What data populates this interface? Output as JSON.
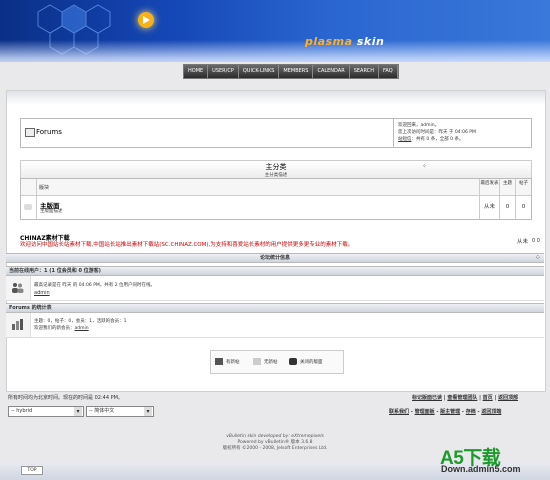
{
  "brand": {
    "name_plasma": "plasma",
    "name_skin": "skin"
  },
  "nav": [
    "HOME",
    "USER/CP",
    "QUICK-LINKS",
    "MEMBERS",
    "CALENDAR",
    "SEARCH",
    "FAQ"
  ],
  "breadcrumb": {
    "title": "Forums"
  },
  "welcome": {
    "line1": "欢迎回来，admin。",
    "line2": "您上次访问时间是：昨天 于 04:06 PM",
    "line3_link": "站短信",
    "line3_rest": "：共有 0 条，全部 0 条。"
  },
  "category": {
    "title": "主分类",
    "subtitle": "主分类描述"
  },
  "table_headers": {
    "forum": "版块",
    "last_post": "最后发表",
    "threads": "主题",
    "posts": "帖子"
  },
  "forum_row": {
    "name": "主版面",
    "desc": "主版面描述",
    "last_post": "从未",
    "threads": "0",
    "posts": "0"
  },
  "ad": {
    "title": "CHINAZ素材下载",
    "text": "欢迎访问中国站长站素材下载,中国站长站推出素材下载站(SC.CHINAZ.COM),为支持和喜爱站长素材的用户提供更多更专业的素材下载。",
    "last_post": "从未",
    "count": "0 0"
  },
  "stats": {
    "header": "论坛统计信息",
    "online_title": "当前在线用户：1 (1 位会员和 0 位游客)",
    "online_text": "最高记录是在 昨天 的 04:06 PM，共有 2 位用户同时在线。",
    "online_user": "admin",
    "forum_stats_title": "Forums 的统计表",
    "forum_stats_text": "主题：0，帖子：0，会员：1，活跃的会员：1",
    "newest_label": "欢迎我们的新会员：",
    "newest_user": "admin"
  },
  "legend": {
    "new": "有新帖",
    "nonew": "无新帖",
    "closed": "关闭的版面"
  },
  "footer": {
    "timezone": "所有时间均为北京时间。现在的时间是 02:44 PM。",
    "links_top": [
      "标记版面已读",
      "查看管理团队",
      "首页",
      "返回顶部"
    ],
    "style_select": "-- hybrid",
    "lang_select": "-- 简体中文",
    "links_bottom": [
      "联系我们",
      "管理面板",
      "版主管理",
      "存档",
      "返回顶端"
    ],
    "credit1": "vBulletin skin developed by: eXtremepixels",
    "credit2": "Powered by vBulletin® 版本 3.6.8",
    "credit3": "版权所有 ©2000 - 2008, Jelsoft Enterprises Ltd.",
    "top_tab": "TOP"
  },
  "watermark": {
    "logo": "A5下载",
    "url": "Down.admin5.com"
  }
}
